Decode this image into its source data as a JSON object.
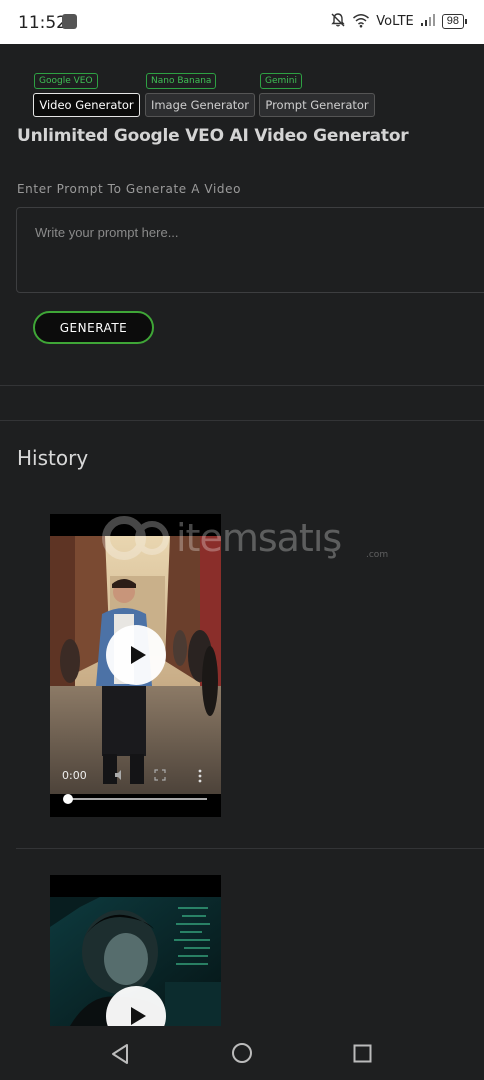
{
  "status_bar": {
    "time": "11:52",
    "network": "VoLTE",
    "battery": "98"
  },
  "tabs": [
    {
      "badge": "Google VEO",
      "label": "Video Generator",
      "active": true
    },
    {
      "badge": "Nano Banana",
      "label": "Image Generator",
      "active": false
    },
    {
      "badge": "Gemini",
      "label": "Prompt Generator",
      "active": false
    }
  ],
  "page_title": "Unlimited Google VEO AI Video Generator",
  "prompt": {
    "label": "Enter Prompt To Generate A Video",
    "placeholder": "Write your prompt here...",
    "value": ""
  },
  "generate_label": "GENERATE",
  "history": {
    "title": "History",
    "videos": [
      {
        "time": "0:00",
        "progress": 0
      },
      {
        "time": "",
        "progress": 0
      }
    ]
  },
  "watermark": {
    "text": "itemsatış",
    "suffix": ".com"
  },
  "colors": {
    "accent": "#3fa637",
    "badge": "#2ea043",
    "background": "#1e1f20"
  },
  "icons": [
    "bell-off-icon",
    "wifi-icon",
    "signal-icon",
    "battery-icon",
    "play-icon",
    "volume-icon",
    "fullscreen-icon",
    "more-vert-icon",
    "back-nav-icon",
    "home-nav-icon",
    "recents-nav-icon"
  ]
}
